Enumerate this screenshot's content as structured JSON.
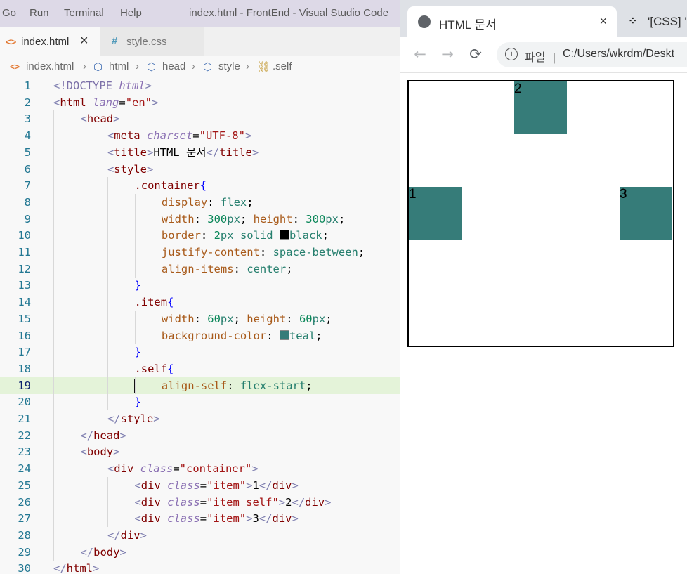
{
  "vscode": {
    "menu": [
      "Go",
      "Run",
      "Terminal",
      "Help"
    ],
    "window_title": "index.html - FrontEnd - Visual Studio Code",
    "tabs": [
      {
        "icon": "<>",
        "label": "index.html",
        "close": "×"
      },
      {
        "icon": "#",
        "label": "style.css"
      }
    ],
    "breadcrumbs": [
      "index.html",
      "html",
      "head",
      "style",
      ".self"
    ],
    "current_line": 19,
    "swatches": {
      "black": "#000000",
      "teal": "#367c79"
    },
    "code_lines": [
      "<!DOCTYPE html>",
      "<html lang=\"en\">",
      "    <head>",
      "        <meta charset=\"UTF-8\">",
      "        <title>HTML 문서</title>",
      "        <style>",
      "            .container{",
      "                display: flex;",
      "                width: 300px; height: 300px;",
      "                border: 2px solid black;",
      "                justify-content: space-between;",
      "                align-items: center;",
      "            }",
      "            .item{",
      "                width: 60px; height: 60px;",
      "                background-color: teal;",
      "            }",
      "            .self{",
      "                align-self: flex-start;",
      "            }",
      "        </style>",
      "    </head>",
      "    <body>",
      "        <div class=\"container\">",
      "            <div class=\"item\">1</div>",
      "            <div class=\"item self\">2</div>",
      "            <div class=\"item\">3</div>",
      "        </div>",
      "    </body>",
      "</html>"
    ]
  },
  "browser": {
    "tabs": [
      {
        "label": "HTML 문서",
        "close": "×"
      },
      {
        "label": "'[CSS] '"
      }
    ],
    "address": {
      "scheme": "파일",
      "separator": "|",
      "url": "C:/Users/wkrdm/Deskt"
    },
    "page": {
      "items": [
        "1",
        "2",
        "3"
      ],
      "item_color": "#367c79",
      "border_color": "#000000"
    }
  }
}
